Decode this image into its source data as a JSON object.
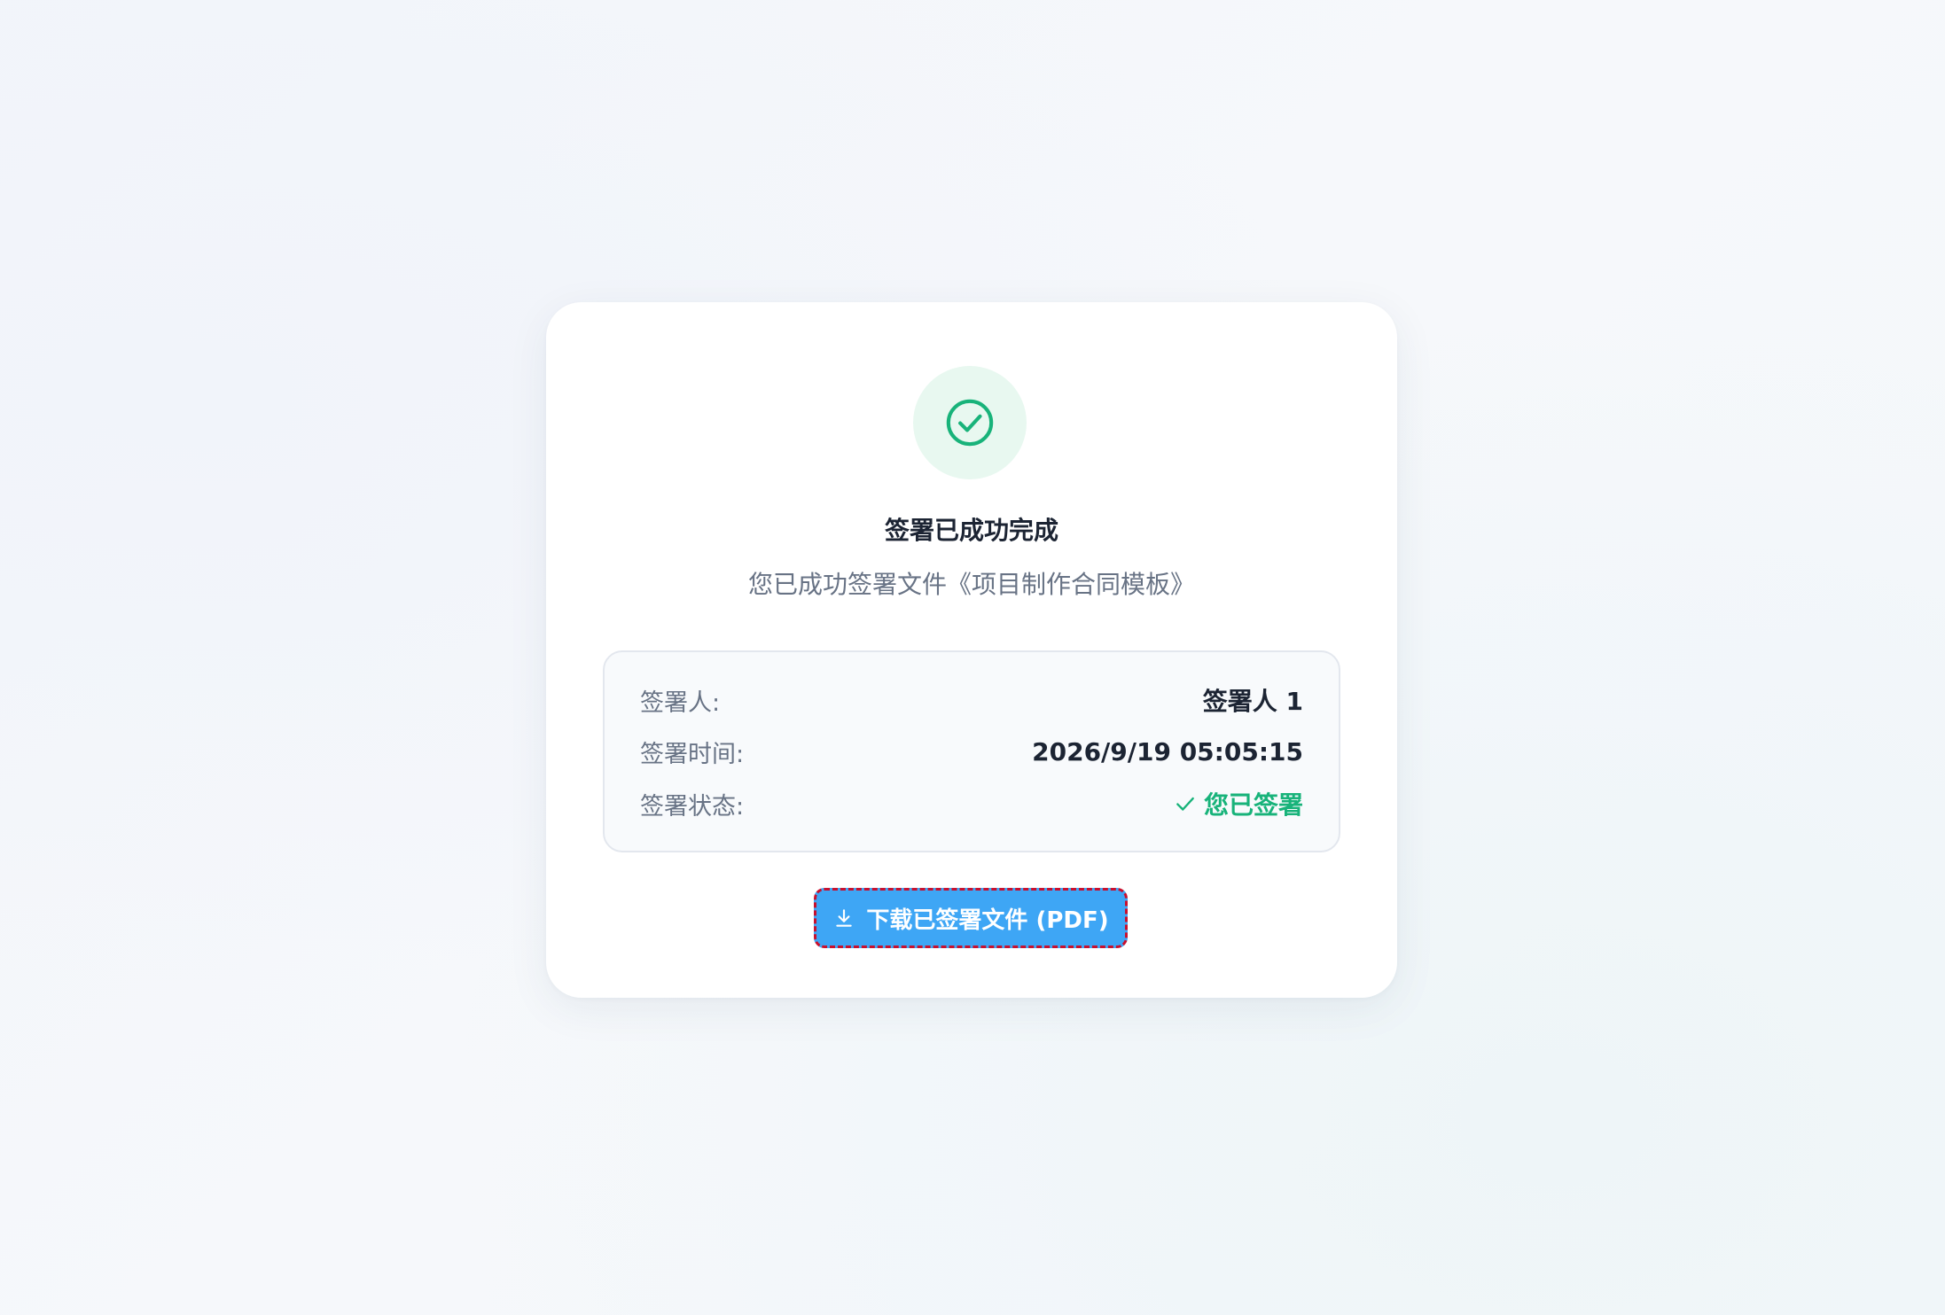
{
  "result": {
    "title": "签署已成功完成",
    "subtitle": "您已成功签署文件《项目制作合同模板》"
  },
  "details": {
    "signer_label": "签署人:",
    "signer_value": "签署人 1",
    "time_label": "签署时间:",
    "time_value": "2026/9/19 05:05:15",
    "status_label": "签署状态:",
    "status_value": "您已签署"
  },
  "actions": {
    "download_label": "下载已签署文件 (PDF)"
  },
  "icons": {
    "success": "check-circle-icon",
    "status": "check-icon",
    "download": "download-icon"
  },
  "colors": {
    "success_green": "#18b37a",
    "success_bg": "#e8f8f0",
    "primary_blue": "#3ea6f5",
    "highlight_border": "#c8102e"
  }
}
